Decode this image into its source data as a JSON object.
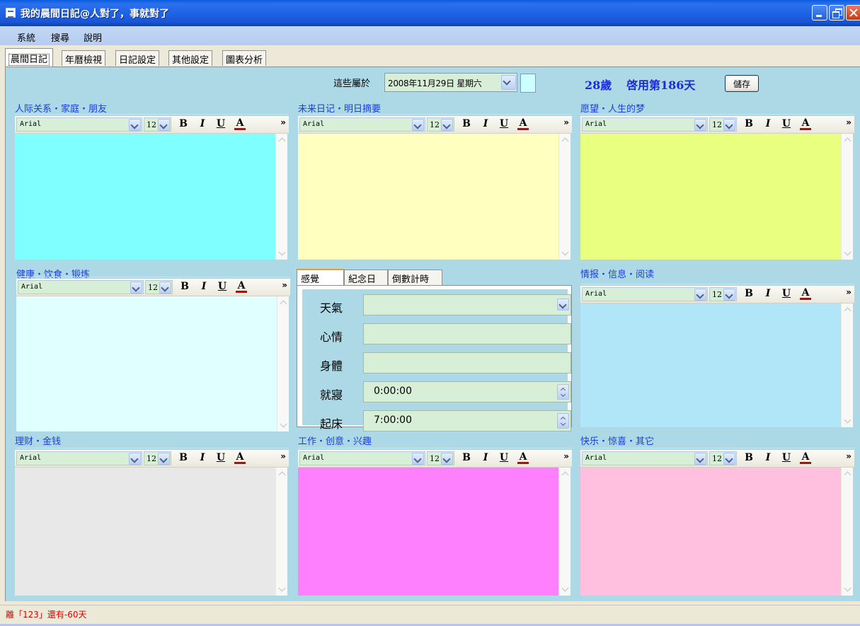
{
  "window": {
    "title": "我的晨間日記@人對了，事就對了"
  },
  "menu": [
    "系統",
    "搜尋",
    "說明"
  ],
  "tabs": [
    "晨間日記",
    "年曆檢視",
    "日記設定",
    "其他設定",
    "圖表分析"
  ],
  "header": {
    "label": "這些屬於",
    "date": "2008年11月29日 星期六",
    "age": "28歲",
    "days": "啓用第186天",
    "save": "儲存",
    "swatch_color": "#CCFFFF"
  },
  "toolbar": {
    "font": "Arial",
    "size": "12",
    "bold": "B",
    "italic": "I",
    "underline": "U",
    "color": "A",
    "more": "»"
  },
  "panels": [
    {
      "title": "人际关系・家庭・朋友",
      "color": "#7FFFFF"
    },
    {
      "title": "未来日记・明日摘要",
      "color": "#FFFFC0"
    },
    {
      "title": "愿望・人生的梦",
      "color": "#E8FF80"
    },
    {
      "title": "健康・饮食・锻炼",
      "color": "#E0FFFF"
    },
    {
      "title": "情报・信息・阅读",
      "color": "#B0E6F8"
    },
    {
      "title": "理财・金钱",
      "color": "#E8E8E8"
    },
    {
      "title": "工作・创意・兴趣",
      "color": "#FF80FF"
    },
    {
      "title": "快乐・惊喜・其它",
      "color": "#FFC0E0"
    }
  ],
  "feel": {
    "tabs": [
      "感覺",
      "紀念日",
      "倒數計時"
    ],
    "weather_label": "天氣",
    "mood_label": "心情",
    "body_label": "身體",
    "sleep_label": "就寢",
    "sleep_value": "0:00:00",
    "wake_label": "起床",
    "wake_value": "7:00:00"
  },
  "status": "離「123」還有-60天"
}
